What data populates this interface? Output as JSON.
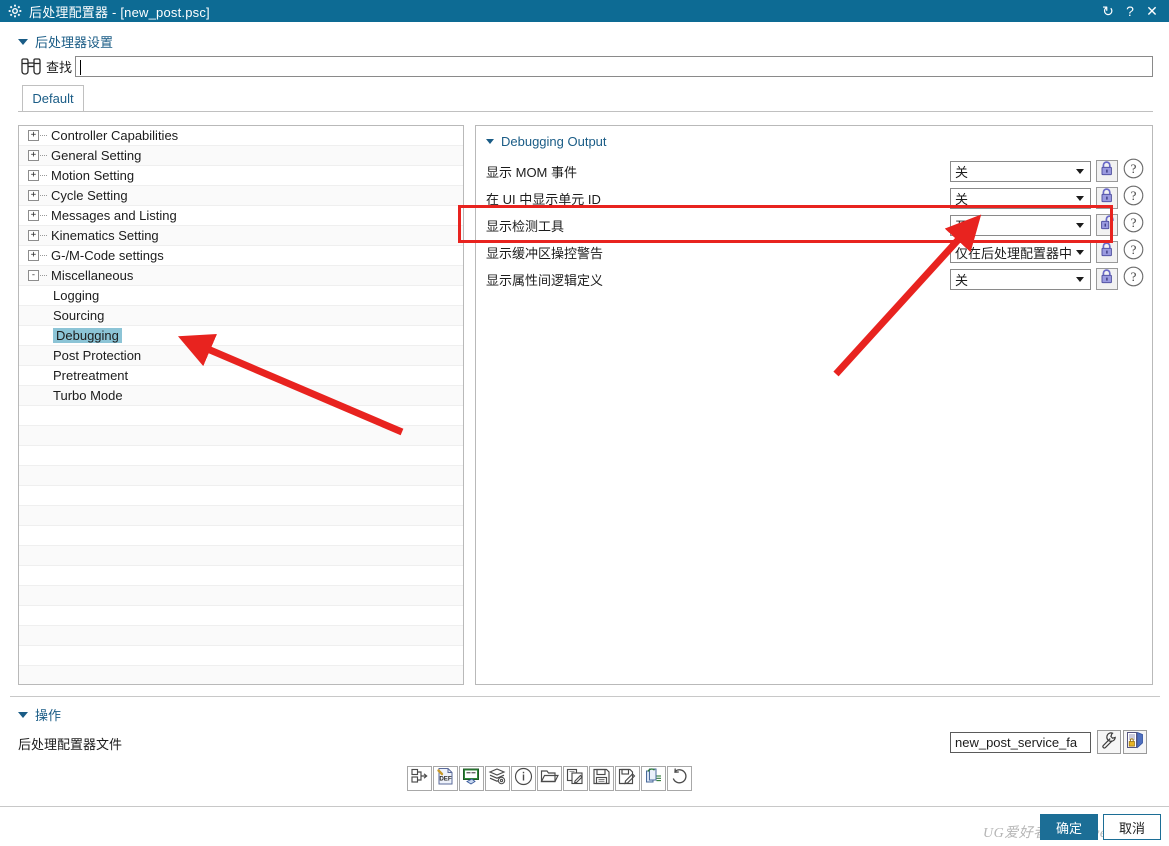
{
  "window": {
    "title": "后处理配置器 - [new_post.psc]",
    "gear_icon": "gear-icon",
    "controls": [
      {
        "name": "refresh",
        "glyph": "↻"
      },
      {
        "name": "help",
        "glyph": "?"
      },
      {
        "name": "close",
        "glyph": "✕"
      }
    ]
  },
  "post_settings": {
    "header": "后处理器设置",
    "find": {
      "label": "查找",
      "icon": "binoculars-icon",
      "value": "",
      "placeholder": ""
    },
    "tab": {
      "label": "Default"
    }
  },
  "tree": {
    "items": [
      {
        "label": "Controller Capabilities",
        "level": 0,
        "expander": "+",
        "selected": false
      },
      {
        "label": "General Setting",
        "level": 0,
        "expander": "+",
        "selected": false
      },
      {
        "label": "Motion Setting",
        "level": 0,
        "expander": "+",
        "selected": false
      },
      {
        "label": "Cycle Setting",
        "level": 0,
        "expander": "+",
        "selected": false
      },
      {
        "label": "Messages and Listing",
        "level": 0,
        "expander": "+",
        "selected": false
      },
      {
        "label": "Kinematics Setting",
        "level": 0,
        "expander": "+",
        "selected": false
      },
      {
        "label": "G-/M-Code settings",
        "level": 0,
        "expander": "+",
        "selected": false
      },
      {
        "label": "Miscellaneous",
        "level": 0,
        "expander": "-",
        "selected": false
      },
      {
        "label": "Logging",
        "level": 1,
        "expander": "",
        "selected": false
      },
      {
        "label": "Sourcing",
        "level": 1,
        "expander": "",
        "selected": false
      },
      {
        "label": "Debugging",
        "level": 1,
        "expander": "",
        "selected": true
      },
      {
        "label": "Post Protection",
        "level": 1,
        "expander": "",
        "selected": false
      },
      {
        "label": "Pretreatment",
        "level": 1,
        "expander": "",
        "selected": false
      },
      {
        "label": "Turbo Mode",
        "level": 1,
        "expander": "",
        "selected": false
      }
    ],
    "empty_rows": 14
  },
  "settings": {
    "group_title": "Debugging Output",
    "rows": [
      {
        "label": "显示 MOM 事件",
        "value": "关",
        "locked": true,
        "help": "?"
      },
      {
        "label": "在 UI 中显示单元 ID",
        "value": "关",
        "locked": true,
        "help": "?"
      },
      {
        "label": "显示检测工具",
        "value": "开",
        "locked": false,
        "help": "?"
      },
      {
        "label": "显示缓冲区操控警告",
        "value": "仅在后处理配置器中",
        "locked": true,
        "help": "?"
      },
      {
        "label": "显示属性间逻辑定义",
        "value": "关",
        "locked": true,
        "help": "?"
      }
    ]
  },
  "operations": {
    "header": "操作",
    "subtitle": "后处理配置器文件",
    "file_select": {
      "value": "new_post_service_fa"
    },
    "wrench_icon": "wrench-icon",
    "security_icon": "security-lock-icon",
    "toolbar": [
      {
        "name": "export-definition-icon",
        "title": ""
      },
      {
        "name": "def-file-icon",
        "title": "DEF"
      },
      {
        "name": "screen-edit-icon",
        "title": ""
      },
      {
        "name": "layers-settings-icon",
        "title": ""
      },
      {
        "name": "info-icon",
        "title": ""
      },
      {
        "name": "open-folder-icon",
        "title": ""
      },
      {
        "name": "copy-edit-icon",
        "title": ""
      },
      {
        "name": "save-icon",
        "title": ""
      },
      {
        "name": "save-as-edit-icon",
        "title": ""
      },
      {
        "name": "duplicate-list-icon",
        "title": ""
      },
      {
        "name": "undo-icon",
        "title": ""
      }
    ]
  },
  "footer": {
    "ok_label": "确定",
    "cancel_label": "取消",
    "watermark": "UG爱好者论坛@werttey"
  },
  "colors": {
    "titlebar": "#0d6b94",
    "accent_text": "#1a5c86",
    "selection": "#8cc4d6",
    "annotation": "#e8231f",
    "ok_button": "#1c6e96"
  }
}
